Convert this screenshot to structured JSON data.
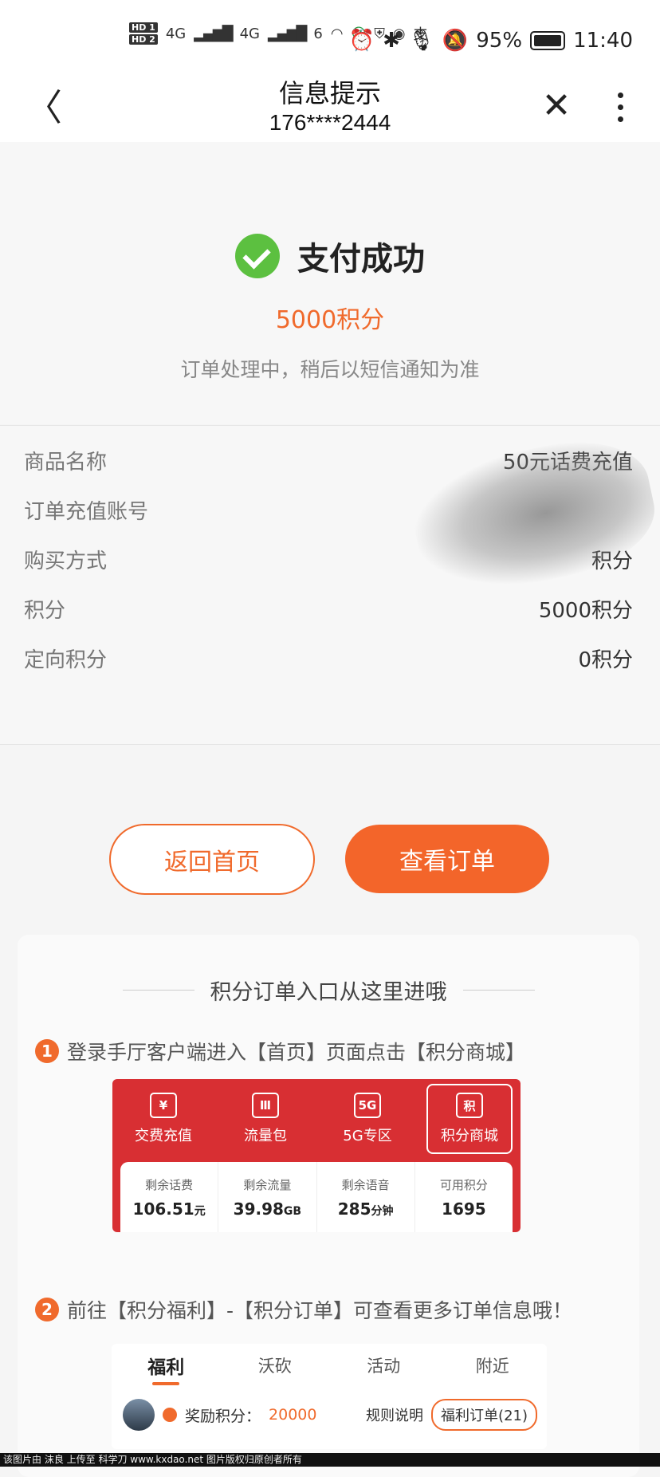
{
  "status_bar": {
    "hd1": "HD 1",
    "hd2": "HD 2",
    "net1": "4G",
    "net2": "4G",
    "wifi": "6",
    "zhi": "支",
    "battery_pct": "95%",
    "time": "11:40"
  },
  "nav": {
    "title": "信息提示",
    "subtitle": "176****2444"
  },
  "result": {
    "status": "支付成功",
    "amount": "5000积分",
    "note": "订单处理中，稍后以短信通知为准"
  },
  "details": [
    {
      "key": "商品名称",
      "value": "50元话费充值"
    },
    {
      "key": "订单充值账号",
      "value": ""
    },
    {
      "key": "购买方式",
      "value": "积分"
    },
    {
      "key": "积分",
      "value": "5000积分"
    },
    {
      "key": "定向积分",
      "value": "0积分"
    }
  ],
  "buttons": {
    "home": "返回首页",
    "order": "查看订单"
  },
  "guide": {
    "title": "积分订单入口从这里进哦",
    "step1_num": "1",
    "step1": "登录手厅客户端进入【首页】页面点击【积分商城】",
    "step2_num": "2",
    "step2": "前往【积分福利】-【积分订单】可查看更多订单信息哦！",
    "shot1": {
      "menu": [
        {
          "icon": "¥",
          "label": "交费充值"
        },
        {
          "icon": "Ⅲ",
          "label": "流量包"
        },
        {
          "icon": "5G",
          "label": "5G专区"
        },
        {
          "icon": "积",
          "label": "积分商城"
        }
      ],
      "stats": [
        {
          "label": "剩余话费",
          "num": "106.51",
          "unit": "元"
        },
        {
          "label": "剩余流量",
          "num": "39.98",
          "unit": "GB"
        },
        {
          "label": "剩余语音",
          "num": "285",
          "unit": "分钟"
        },
        {
          "label": "可用积分",
          "num": "1695",
          "unit": ""
        }
      ]
    },
    "shot2": {
      "tabs": [
        "福利",
        "沃砍",
        "活动",
        "附近"
      ],
      "reward_label": "奖励积分：",
      "reward_value": "20000",
      "rules": "规则说明",
      "orders": "福利订单(21)"
    }
  },
  "footer": "该图片由 沫良 上传至 科学刀 www.kxdao.net 图片版权归原创者所有"
}
